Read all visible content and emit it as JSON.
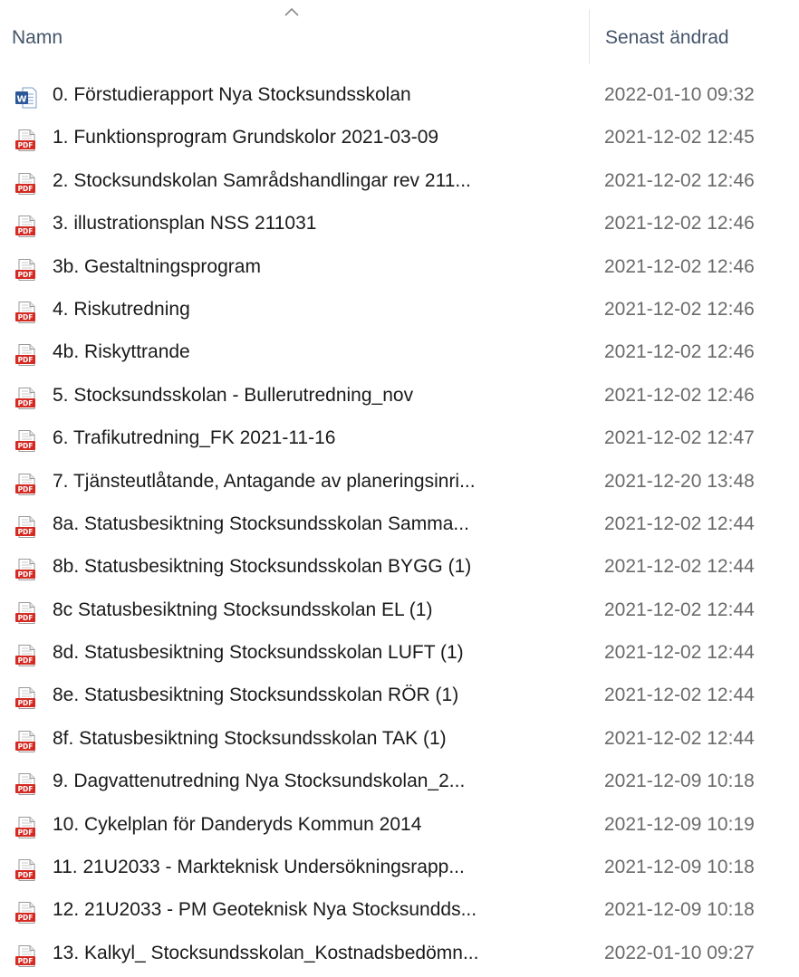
{
  "header": {
    "name_label": "Namn",
    "date_label": "Senast ändrad",
    "sort_direction": "ascending"
  },
  "colors": {
    "header_text": "#44546a",
    "pdf_red": "#d42a22",
    "word_blue": "#2b5797",
    "date_text": "#6b6b6b"
  },
  "files": [
    {
      "icon": "word-icon",
      "name": "0.  Förstudierapport  Nya Stocksundsskolan",
      "modified": "2022-01-10 09:32"
    },
    {
      "icon": "pdf-icon",
      "name": "1. Funktionsprogram Grundskolor 2021-03-09",
      "modified": "2021-12-02 12:45"
    },
    {
      "icon": "pdf-icon",
      "name": "2. Stocksundskolan Samrådshandlingar rev 211...",
      "modified": "2021-12-02 12:46"
    },
    {
      "icon": "pdf-icon",
      "name": "3. illustrationsplan NSS 211031",
      "modified": "2021-12-02 12:46"
    },
    {
      "icon": "pdf-icon",
      "name": "3b. Gestaltningsprogram",
      "modified": "2021-12-02 12:46"
    },
    {
      "icon": "pdf-icon",
      "name": "4. Riskutredning",
      "modified": "2021-12-02 12:46"
    },
    {
      "icon": "pdf-icon",
      "name": "4b. Riskyttrande",
      "modified": "2021-12-02 12:46"
    },
    {
      "icon": "pdf-icon",
      "name": "5. Stocksundsskolan - Bullerutredning_nov",
      "modified": "2021-12-02 12:46"
    },
    {
      "icon": "pdf-icon",
      "name": "6. Trafikutredning_FK 2021-11-16",
      "modified": "2021-12-02 12:47"
    },
    {
      "icon": "pdf-icon",
      "name": "7. Tjänsteutlåtande, Antagande av planeringsinri...",
      "modified": "2021-12-20 13:48"
    },
    {
      "icon": "pdf-icon",
      "name": "8a. Statusbesiktning Stocksundsskolan Samma...",
      "modified": "2021-12-02 12:44"
    },
    {
      "icon": "pdf-icon",
      "name": "8b. Statusbesiktning Stocksundsskolan BYGG (1)",
      "modified": "2021-12-02 12:44"
    },
    {
      "icon": "pdf-icon",
      "name": "8c Statusbesiktning Stocksundsskolan EL (1)",
      "modified": "2021-12-02 12:44"
    },
    {
      "icon": "pdf-icon",
      "name": "8d. Statusbesiktning Stocksundsskolan LUFT (1)",
      "modified": "2021-12-02 12:44"
    },
    {
      "icon": "pdf-icon",
      "name": "8e. Statusbesiktning Stocksundsskolan RÖR (1)",
      "modified": "2021-12-02 12:44"
    },
    {
      "icon": "pdf-icon",
      "name": "8f. Statusbesiktning Stocksundsskolan TAK (1)",
      "modified": "2021-12-02 12:44"
    },
    {
      "icon": "pdf-icon",
      "name": "9. Dagvattenutredning Nya Stocksundskolan_2...",
      "modified": "2021-12-09 10:18"
    },
    {
      "icon": "pdf-icon",
      "name": "10. Cykelplan för Danderyds Kommun 2014",
      "modified": "2021-12-09 10:19"
    },
    {
      "icon": "pdf-icon",
      "name": "11. 21U2033 - Markteknisk Undersökningsrapp...",
      "modified": "2021-12-09 10:18"
    },
    {
      "icon": "pdf-icon",
      "name": "12. 21U2033 - PM Geoteknisk Nya Stocksundds...",
      "modified": "2021-12-09 10:18"
    },
    {
      "icon": "pdf-icon",
      "name": "13. Kalkyl_ Stocksundsskolan_Kostnadsbedömn...",
      "modified": "2022-01-10 09:27"
    }
  ]
}
